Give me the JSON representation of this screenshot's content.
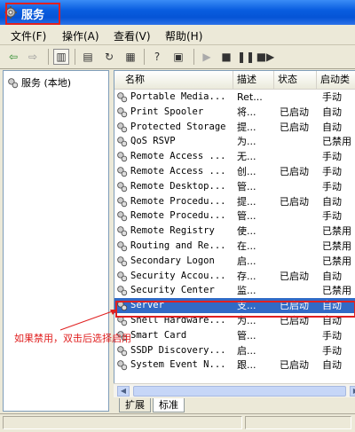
{
  "window": {
    "title": "服务"
  },
  "menu": [
    "文件(F)",
    "操作(A)",
    "查看(V)",
    "帮助(H)"
  ],
  "toolbar": {
    "buttons": [
      "back-arrow-icon",
      "forward-arrow-icon",
      "show-tree-icon",
      "properties-icon",
      "refresh-icon",
      "export-list-icon",
      "help-icon",
      "show-description-icon",
      "start-icon",
      "stop-icon",
      "pause-icon",
      "restart-icon"
    ]
  },
  "tree": {
    "root_label": "服务 (本地)"
  },
  "columns": {
    "name": "名称",
    "desc": "描述",
    "status": "状态",
    "startup": "启动类"
  },
  "rows": [
    {
      "name": "Portable Media...",
      "desc": "Ret...",
      "status": "",
      "startup": "手动"
    },
    {
      "name": "Print Spooler",
      "desc": "将...",
      "status": "已启动",
      "startup": "自动"
    },
    {
      "name": "Protected Storage",
      "desc": "提...",
      "status": "已启动",
      "startup": "自动"
    },
    {
      "name": "QoS RSVP",
      "desc": "为...",
      "status": "",
      "startup": "已禁用"
    },
    {
      "name": "Remote Access ...",
      "desc": "无...",
      "status": "",
      "startup": "手动"
    },
    {
      "name": "Remote Access ...",
      "desc": "创...",
      "status": "已启动",
      "startup": "手动"
    },
    {
      "name": "Remote Desktop...",
      "desc": "管...",
      "status": "",
      "startup": "手动"
    },
    {
      "name": "Remote Procedu...",
      "desc": "提...",
      "status": "已启动",
      "startup": "自动"
    },
    {
      "name": "Remote Procedu...",
      "desc": "管...",
      "status": "",
      "startup": "手动"
    },
    {
      "name": "Remote Registry",
      "desc": "使...",
      "status": "",
      "startup": "已禁用"
    },
    {
      "name": "Routing and Re...",
      "desc": "在...",
      "status": "",
      "startup": "已禁用"
    },
    {
      "name": "Secondary Logon",
      "desc": "启...",
      "status": "",
      "startup": "已禁用"
    },
    {
      "name": "Security Accou...",
      "desc": "存...",
      "status": "已启动",
      "startup": "自动"
    },
    {
      "name": "Security Center",
      "desc": "监...",
      "status": "",
      "startup": "已禁用"
    },
    {
      "name": "Server",
      "desc": "支...",
      "status": "已启动",
      "startup": "自动",
      "selected": true
    },
    {
      "name": "Shell Hardware...",
      "desc": "为...",
      "status": "已启动",
      "startup": "自动"
    },
    {
      "name": "Smart Card",
      "desc": "管...",
      "status": "",
      "startup": "手动"
    },
    {
      "name": "SSDP Discovery...",
      "desc": "启...",
      "status": "",
      "startup": "手动"
    },
    {
      "name": "System Event N...",
      "desc": "跟...",
      "status": "已启动",
      "startup": "自动"
    }
  ],
  "tabs": [
    "扩展",
    "标准"
  ],
  "annotation": {
    "text": "如果禁用，双击后选择启用",
    "color": "#e02020"
  },
  "colors": {
    "titlebar": "#0a5ee0",
    "selection": "#316ac5",
    "highlight": "#e02020"
  }
}
